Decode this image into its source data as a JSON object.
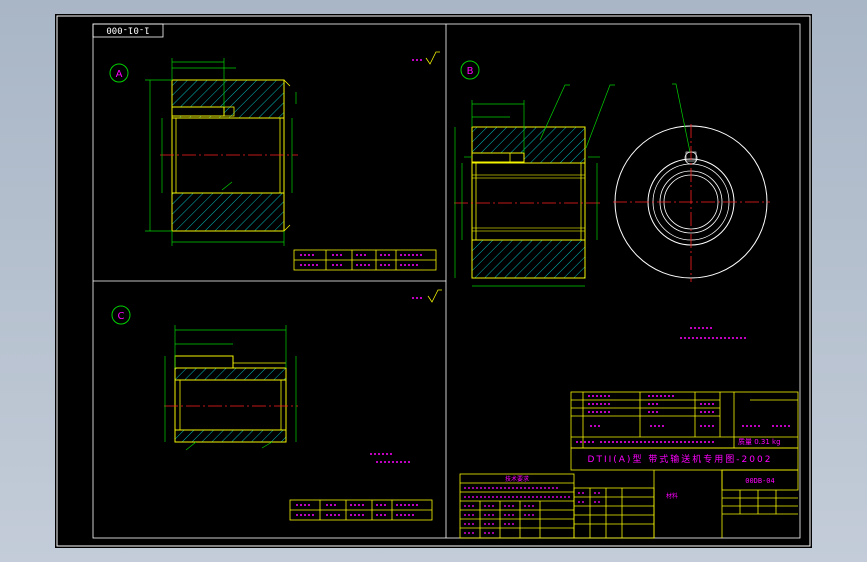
{
  "drawing": {
    "sheet_code": "1-01-000",
    "view_labels": [
      "A",
      "B",
      "C"
    ],
    "part_title": "DTII(A)型 带式输送机专用图-2002",
    "part_number": "00DB-04",
    "mass_text": "质量 0.31 kg",
    "tech_note": "技术要求",
    "material_note": "材料"
  },
  "colors": {
    "background": "#000000",
    "outline": "#f4f400",
    "hatch": "#00e8e8",
    "centerline": "#ff2020",
    "dimension": "#00d000",
    "text": "#ff00ff",
    "white": "#ffffff",
    "page": "#b8c2cf"
  },
  "icons": [
    "roughness-symbol-icon",
    "balloon-icon"
  ]
}
